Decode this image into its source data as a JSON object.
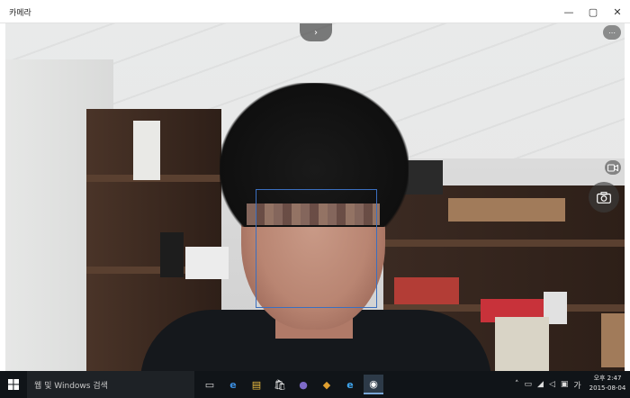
{
  "window": {
    "title": "카메라",
    "minimize_glyph": "—",
    "maximize_glyph": "▢",
    "close_glyph": "✕"
  },
  "camera": {
    "next_glyph": "›",
    "more_glyph": "⋯",
    "video_mode_icon": "video-camera-icon",
    "photo_capture_icon": "camera-icon"
  },
  "taskbar": {
    "search_placeholder": "웹 및 Windows 검색",
    "pinned_apps": [
      {
        "name": "task-view-icon",
        "glyph": "▭"
      },
      {
        "name": "edge-icon",
        "glyph": "e"
      },
      {
        "name": "file-explorer-icon",
        "glyph": "▤"
      },
      {
        "name": "store-icon",
        "glyph": "🛍"
      },
      {
        "name": "media-icon",
        "glyph": "●"
      },
      {
        "name": "security-icon",
        "glyph": "◆"
      },
      {
        "name": "ie-icon",
        "glyph": "e"
      },
      {
        "name": "camera-app-icon",
        "glyph": "◉"
      }
    ],
    "clock_time": "오후 2:47",
    "clock_date": "2015-08-04"
  },
  "colors": {
    "taskbar_bg": "#101418",
    "face_box": "#3b6fbf",
    "active_app": "#7aa6d6"
  }
}
